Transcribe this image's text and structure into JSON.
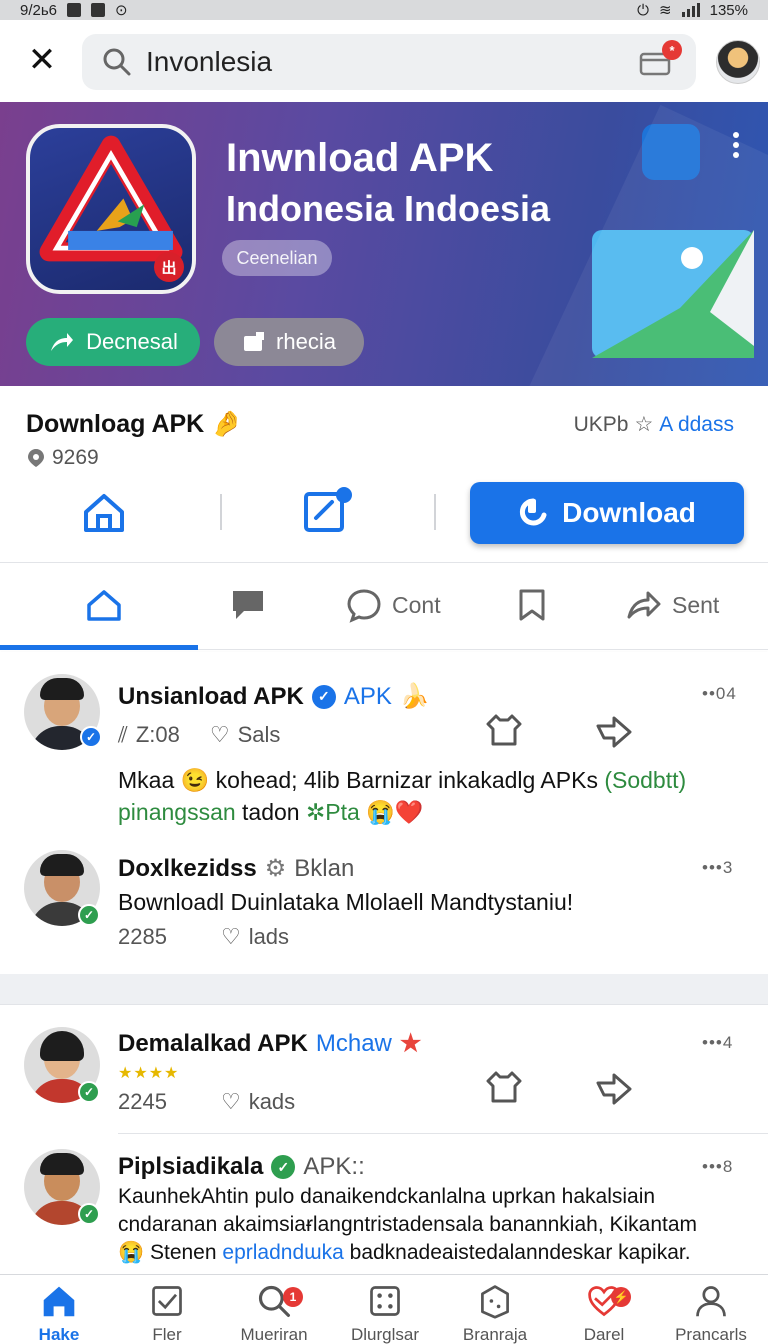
{
  "status_bar": {
    "time": "9/2ь6",
    "battery": "135%"
  },
  "search": {
    "value": "Invonlesia",
    "cart_badge": "*"
  },
  "banner": {
    "title": "Inwnload APK",
    "subtitle": "Indonesia Indoesia",
    "chip": "Ceenelian",
    "primary_button": "Decnesal",
    "secondary_button": "rhecia",
    "icon_badge": "出"
  },
  "app_info": {
    "title": "Downloag APK",
    "rating": "9269",
    "size": "UKPb",
    "class_label": "A ddass"
  },
  "actions": {
    "download_label": "Download"
  },
  "tabs": [
    {
      "label": ""
    },
    {
      "label": ""
    },
    {
      "label": "Cont"
    },
    {
      "label": ""
    },
    {
      "label": "Sent"
    }
  ],
  "posts": [
    {
      "name": "Unsianload APK",
      "tag": "APK",
      "stat_left": "Z:08",
      "stat_right": "Sals",
      "menu": "••04",
      "text_line1": "Mkaa 😉 kohead; 4lib Barnizar inkakadlg APKs",
      "text_line1_green": "(Sodbtt)",
      "text_line2_green": "pinangssan",
      "text_line2": "tadon",
      "text_line2_green2": "✲Pta",
      "text_line2_end": "😭❤️"
    },
    {
      "name": "Doxlkezidss",
      "tag": "Bklan",
      "menu": "•••3",
      "text": "Bownloadl Duinlataka Mlolaell Mandtystaniu!",
      "stat_left": "2285",
      "stat_right": "lads"
    },
    {
      "name": "Demalalkad APK",
      "tag": "Mchaw",
      "stars": "★★★★",
      "menu": "•••4",
      "stat_left": "2245",
      "stat_right": "kads"
    },
    {
      "name": "Piplsiadikala",
      "tag": "APK::",
      "menu": "•••8",
      "text_line1": "KaunhekAhtin pulo danaikendckanlalna uprkan hakalsiain",
      "text_line2": "cndaranan akaimsiaɍlangntristadensala banannkiah, Kikantam",
      "text_line3_a": "😭 Stenen",
      "text_line3_blue": "eprladndɯka",
      "text_line3_b": "badknadeaistedalanndeskar kapikar."
    }
  ],
  "bottom_nav": [
    {
      "label": "Hake",
      "icon": "home-icon"
    },
    {
      "label": "Fler",
      "icon": "checkbox-icon"
    },
    {
      "label": "Mueriran",
      "icon": "search-icon",
      "badge": "1"
    },
    {
      "label": "Dlurglsar",
      "icon": "grid-icon"
    },
    {
      "label": "Branraja",
      "icon": "package-icon"
    },
    {
      "label": "Darel",
      "icon": "heart-icon",
      "badge": "⚡"
    },
    {
      "label": "Prancarls",
      "icon": "profile-icon"
    }
  ],
  "colors": {
    "accent": "#1a73e8",
    "green": "#27ae7a",
    "badge_red": "#e53935"
  }
}
